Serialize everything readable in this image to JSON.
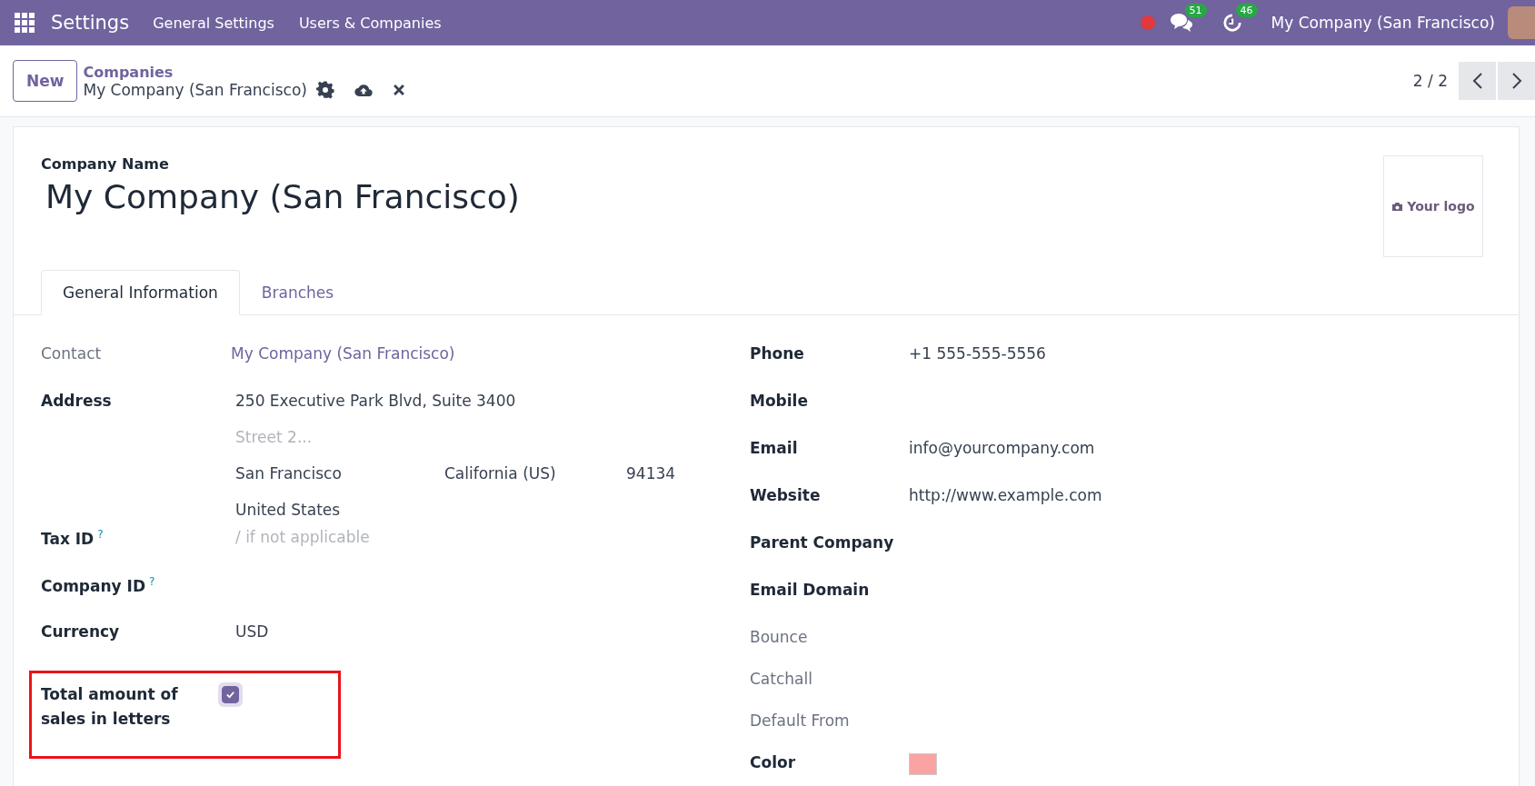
{
  "navbar": {
    "app": "Settings",
    "menus": [
      "General Settings",
      "Users & Companies"
    ],
    "messages_count": "51",
    "activities_count": "46",
    "company": "My Company (San Francisco)"
  },
  "control_panel": {
    "new_button": "New",
    "breadcrumb": "Companies",
    "record": "My Company (San Francisco)",
    "pager": "2 / 2"
  },
  "form": {
    "name_label": "Company Name",
    "name": "My Company (San Francisco)",
    "logo": "Your logo",
    "tabs": [
      {
        "label": "General Information",
        "selected": true
      },
      {
        "label": "Branches",
        "selected": false
      }
    ],
    "left_fields": [
      {
        "kind": "link",
        "label": "Contact",
        "muted": true,
        "value": "My Company (San Francisco)"
      },
      {
        "kind": "address",
        "label": "Address",
        "muted": false,
        "street": "250 Executive Park Blvd, Suite 3400",
        "street2_placeholder": "Street 2...",
        "city": "San Francisco",
        "state": "California (US)",
        "zip": "94134",
        "country": "United States"
      },
      {
        "kind": "input",
        "label": "Tax ID",
        "muted": false,
        "help": "?",
        "placeholder": "/ if not applicable"
      },
      {
        "kind": "input",
        "label": "Company ID",
        "muted": false,
        "help": "?"
      },
      {
        "kind": "text",
        "label": "Currency",
        "muted": false,
        "value": "USD"
      },
      {
        "kind": "checkbox",
        "label": "Total amount of sales in letters",
        "muted": false,
        "checked": true,
        "highlighted": true
      }
    ],
    "right_fields": [
      {
        "kind": "text",
        "label": "Phone",
        "muted": false,
        "value": "+1 555-555-5556"
      },
      {
        "kind": "text",
        "label": "Mobile",
        "muted": false
      },
      {
        "kind": "text",
        "label": "Email",
        "muted": false,
        "value": "info@yourcompany.com"
      },
      {
        "kind": "text",
        "label": "Website",
        "muted": false,
        "value": "http://www.example.com"
      },
      {
        "kind": "text",
        "label": "Parent Company",
        "muted": false
      },
      {
        "kind": "text",
        "label": "Email Domain",
        "muted": false
      },
      {
        "kind": "text",
        "label": "Bounce",
        "muted": true
      },
      {
        "kind": "text",
        "label": "Catchall",
        "muted": true
      },
      {
        "kind": "text",
        "label": "Default From",
        "muted": true
      },
      {
        "kind": "color",
        "label": "Color",
        "muted": false,
        "color": "#f9a3a3"
      }
    ]
  }
}
